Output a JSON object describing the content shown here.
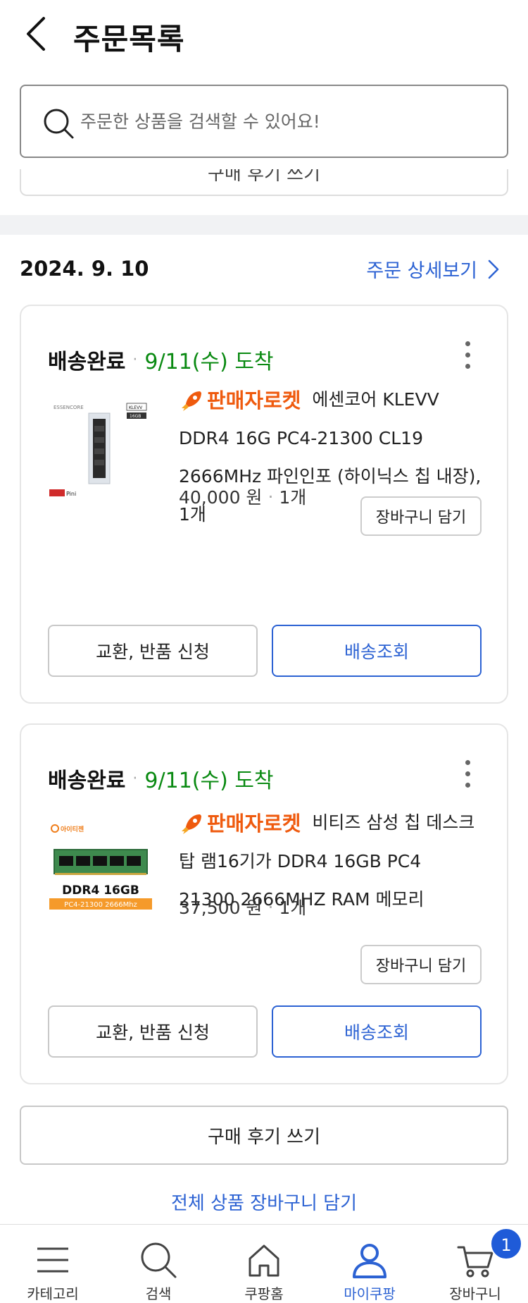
{
  "header": {
    "title": "주문목록"
  },
  "search": {
    "placeholder": "주문한 상품을 검색할 수 있어요!"
  },
  "prev_card": {
    "ghost_text": "구매 후기 쓰기"
  },
  "order": {
    "date": "2024. 9. 10",
    "detail_link": "주문 상세보기"
  },
  "items": [
    {
      "status": "배송완료",
      "arrival": "9/11(수) 도착",
      "badge": "판매자로켓",
      "name": "에센코어 KLEVV DDR4 16G PC4-21300 CL19 2666MHz 파인인포 (하이닉스 칩 내장), 1개",
      "price": "40,000 원",
      "quantity": "1개",
      "cart_button": "장바구니 담기",
      "return_button": "교환, 반품 신청",
      "track_button": "배송조회",
      "thumb_brand": "ESSENCORE",
      "thumb_model": "KLEVV",
      "thumb_size": "16GB",
      "thumb_seller": "Pini"
    },
    {
      "status": "배송완료",
      "arrival": "9/11(수) 도착",
      "badge": "판매자로켓",
      "name": "비티즈 삼성 칩 데스크탑 램16기가 DDR4 16GB PC4 21300 2666MHZ RAM 메모리",
      "price": "37,500 원",
      "quantity": "1개",
      "cart_button": "장바구니 담기",
      "return_button": "교환, 반품 신청",
      "track_button": "배송조회",
      "thumb_brand": "아이티젠",
      "thumb_title": "DDR4 16GB",
      "thumb_sub": "PC4-21300 2666Mhz"
    }
  ],
  "review_button": "구매 후기 쓰기",
  "all_cart_link": "전체 상품 장바구니 담기",
  "nav": {
    "items": [
      {
        "label": "카테고리",
        "icon": "menu-icon"
      },
      {
        "label": "검색",
        "icon": "search-icon"
      },
      {
        "label": "쿠팡홈",
        "icon": "home-icon"
      },
      {
        "label": "마이쿠팡",
        "icon": "user-icon",
        "active": true
      },
      {
        "label": "장바구니",
        "icon": "cart-icon"
      }
    ],
    "cart_count": "1"
  },
  "colors": {
    "accent_blue": "#2c62d3",
    "arrival_green": "#0a8a12",
    "rocket_orange": "#ef5a0e"
  }
}
